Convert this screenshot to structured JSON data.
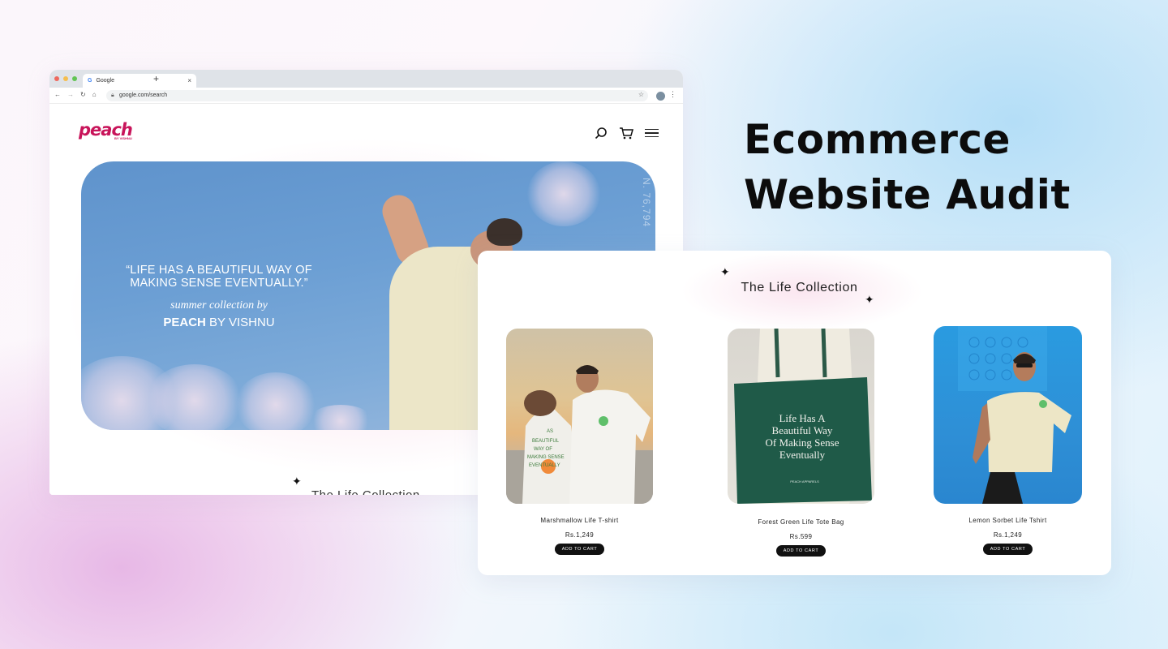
{
  "browser": {
    "tab_title": "Google",
    "tab_close": "×",
    "new_tab": "+",
    "url": "google.com/search",
    "traffic_lights": [
      "#ee6a5f",
      "#f5be4f",
      "#62c554"
    ]
  },
  "site": {
    "logo": "peach",
    "logo_sub": "BY VISHNU",
    "hero_quote": "“LIFE HAS A BEAUTIFUL WAY OF MAKING SENSE EVENTUALLY.”",
    "hero_collection": "summer collection by",
    "hero_brand_bold": "PEACH",
    "hero_brand_rest": " BY VISHNU",
    "hero_side_text": "N. 76,794",
    "section_title_cut": "The Life Collection",
    "brand_color": "#c8145a"
  },
  "headline": {
    "line1": "Ecommerce",
    "line2": "Website Audit"
  },
  "collection": {
    "title": "The Life Collection",
    "products": [
      {
        "name": "Marshmallow Life T-shirt",
        "price": "Rs.1,249",
        "button": "ADD TO CART"
      },
      {
        "name": "Forest Green Life Tote Bag",
        "price": "Rs.599",
        "button": "ADD TO CART",
        "bag_text": "Life Has A Beautiful Way Of Making Sense Eventually",
        "bag_label": "PEACH APPARELS"
      },
      {
        "name": "Lemon Sorbet Life Tshirt",
        "price": "Rs.1,249",
        "button": "ADD TO CART"
      }
    ],
    "shirt_print": "LIFE HAS A BEAUTIFUL WAY OF MAKING SENSE EVENTUALLY"
  }
}
